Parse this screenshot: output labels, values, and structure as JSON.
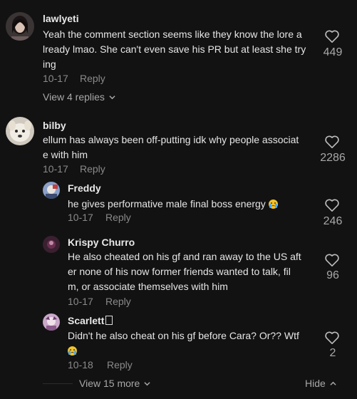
{
  "comments": [
    {
      "username": "lawlyeti",
      "text_lines": [
        "Yeah the comment section seems like they know the lore a",
        "lready lmao. She can't even save his PR but at least she try",
        "ing"
      ],
      "date": "10-17",
      "reply_label": "Reply",
      "likes": "449",
      "view_replies": "View 4 replies"
    },
    {
      "username": "bilby",
      "text_lines": [
        "ellum has always been off-putting idk why people associat",
        "e with him"
      ],
      "date": "10-17",
      "reply_label": "Reply",
      "likes": "2286"
    }
  ],
  "replies": [
    {
      "username": "Freddy",
      "text_lines": [
        "he gives performative male final boss energy"
      ],
      "emoji": "loudly-crying-face",
      "date": "10-17",
      "reply_label": "Reply",
      "likes": "246"
    },
    {
      "username": "Krispy Churro",
      "text_lines": [
        "He also cheated on his gf and ran away to the US aft",
        "er none of his now former friends wanted to talk, fil",
        "m, or associate themselves with him"
      ],
      "date": "10-17",
      "reply_label": "Reply",
      "likes": "96"
    },
    {
      "username": "Scarlett",
      "username_glyph": "missing-glyph-box",
      "text_lines": [
        "Didn't he also cheat on his gf before Cara? Or?? Wtf"
      ],
      "emoji": "loudly-crying-face",
      "date": "10-18",
      "reply_label": "Reply",
      "likes": "2"
    }
  ],
  "footer": {
    "view_more": "View 15 more",
    "hide": "Hide"
  },
  "colors": {
    "background": "#121212",
    "text": "#e6e6e6",
    "muted": "#8a8a8a",
    "username": "#e8e8e8"
  }
}
